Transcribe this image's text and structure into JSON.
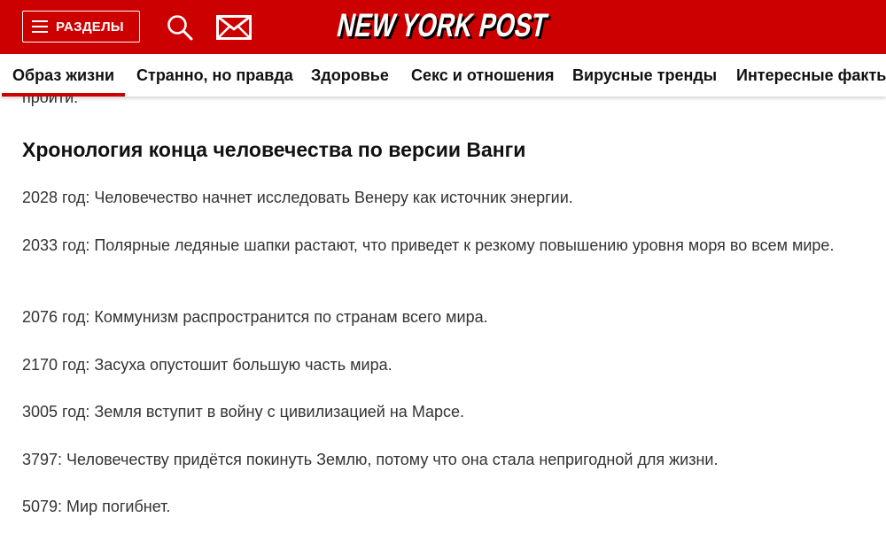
{
  "header": {
    "sections_label": "РАЗДЕЛЫ",
    "logo_text": "NEW YORK POST",
    "brand_color": "#cc0000",
    "icons": [
      "hamburger-icon",
      "search-icon",
      "mail-icon"
    ]
  },
  "nav": {
    "items": [
      {
        "label": "Образ жизни",
        "active": true
      },
      {
        "label": "Странно, но правда",
        "active": false
      },
      {
        "label": "Здоровье",
        "active": false
      },
      {
        "label": "Секс и отношения",
        "active": false
      },
      {
        "label": "Вирусные тренды",
        "active": false
      },
      {
        "label": "Интересные факты",
        "active": false
      }
    ]
  },
  "article": {
    "cut_text": "пройти.",
    "heading": "Хронология конца человечества по версии Ванги",
    "paragraphs": [
      "2028 год: Человечество начнет исследовать Венеру как источник энергии.",
      "2033 год: Полярные ледяные шапки растают, что приведет к резкому повышению уровня моря во всем мире.",
      "2076 год: Коммунизм распространится по странам всего мира.",
      "2170 год: Засуха опустошит большую часть мира.",
      "3005 год: Земля вступит в войну с цивилизацией на Марсе.",
      "3797: Человечеству придётся покинуть Землю, потому что она стала непригодной для жизни.",
      "5079: Мир погибнет."
    ]
  }
}
